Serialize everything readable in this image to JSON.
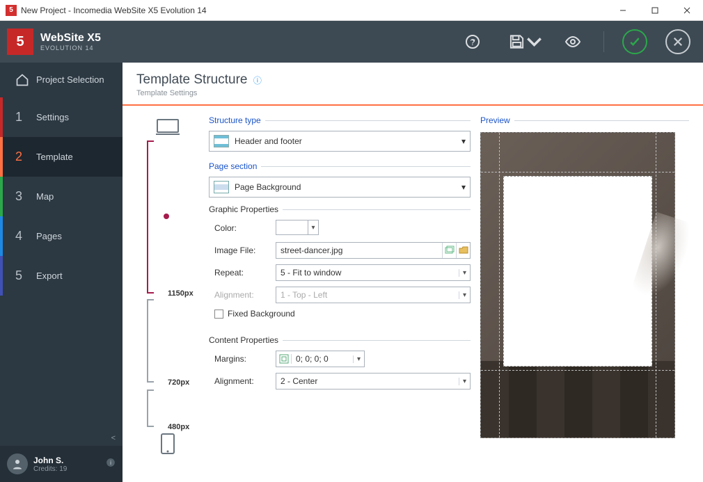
{
  "titlebar": {
    "title": "New Project - Incomedia WebSite X5 Evolution 14"
  },
  "header": {
    "brand_line1": "WebSite X5",
    "brand_line2": "EVOLUTION 14"
  },
  "sidebar": {
    "steps": [
      {
        "label": "Project Selection"
      },
      {
        "num": "1",
        "label": "Settings"
      },
      {
        "num": "2",
        "label": "Template"
      },
      {
        "num": "3",
        "label": "Map"
      },
      {
        "num": "4",
        "label": "Pages"
      },
      {
        "num": "5",
        "label": "Export"
      }
    ],
    "collapse_glyph": "<"
  },
  "user": {
    "name": "John S.",
    "credits": "Credits: 19"
  },
  "page": {
    "title": "Template Structure",
    "subtitle": "Template Settings"
  },
  "breakpoints": {
    "bp1": "1150px",
    "bp2": "720px",
    "bp3": "480px"
  },
  "form": {
    "legend_structure": "Structure type",
    "structure_value": "Header and footer",
    "legend_pagesection": "Page section",
    "pagesection_value": "Page Background",
    "group_graphic": "Graphic Properties",
    "label_color": "Color:",
    "label_image": "Image File:",
    "image_value": "street-dancer.jpg",
    "label_repeat": "Repeat:",
    "repeat_value": "5 - Fit to window",
    "label_alignment": "Alignment:",
    "alignment_value": "1 - Top - Left",
    "checkbox_fixed": "Fixed Background",
    "group_content": "Content Properties",
    "label_margins": "Margins:",
    "margins_value": "0; 0; 0; 0",
    "label_content_align": "Alignment:",
    "content_align_value": "2 - Center"
  },
  "preview": {
    "legend": "Preview"
  }
}
